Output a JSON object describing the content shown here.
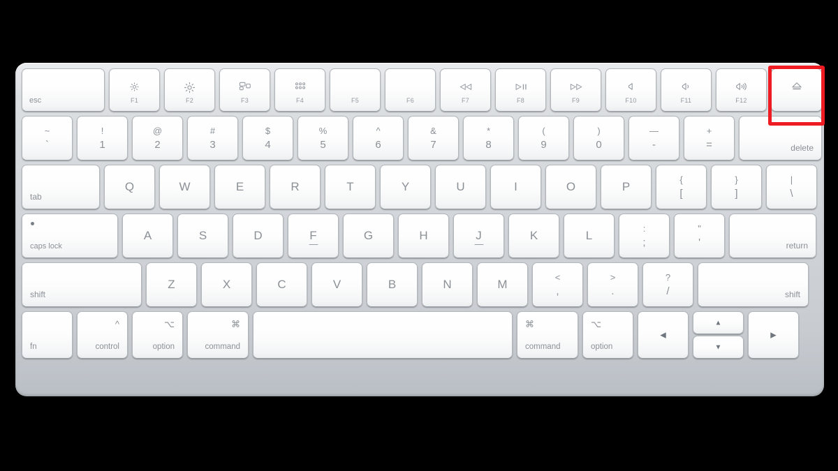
{
  "device": {
    "name": "Apple Magic Keyboard",
    "layout": "US ANSI, compact with eject key"
  },
  "highlight": {
    "target_key": "eject",
    "color": "#ee1c22",
    "shape": "rectangle-outline"
  },
  "background_color": "#000000",
  "rows": {
    "function": [
      {
        "name": "esc",
        "label": "esc",
        "glyph": "",
        "fn": "",
        "style": "esc"
      },
      {
        "name": "f1",
        "label": "",
        "glyph": "☀",
        "fn": "F1",
        "icon": "brightness-down-icon"
      },
      {
        "name": "f2",
        "label": "",
        "glyph": "☀",
        "fn": "F2",
        "icon": "brightness-up-icon"
      },
      {
        "name": "f3",
        "label": "",
        "glyph": "",
        "fn": "F3",
        "icon": "mission-control-icon"
      },
      {
        "name": "f4",
        "label": "",
        "glyph": "",
        "fn": "F4",
        "icon": "launchpad-icon"
      },
      {
        "name": "f5",
        "label": "",
        "glyph": "",
        "fn": "F5",
        "icon": ""
      },
      {
        "name": "f6",
        "label": "",
        "glyph": "",
        "fn": "F6",
        "icon": ""
      },
      {
        "name": "f7",
        "label": "",
        "glyph": "◅◅",
        "fn": "F7",
        "icon": "rewind-icon"
      },
      {
        "name": "f8",
        "label": "",
        "glyph": "▻||",
        "fn": "F8",
        "icon": "play-pause-icon"
      },
      {
        "name": "f9",
        "label": "",
        "glyph": "▻▻",
        "fn": "F9",
        "icon": "fast-forward-icon"
      },
      {
        "name": "f10",
        "label": "",
        "glyph": "◁",
        "fn": "F10",
        "icon": "mute-icon"
      },
      {
        "name": "f11",
        "label": "",
        "glyph": "◁)",
        "fn": "F11",
        "icon": "volume-down-icon"
      },
      {
        "name": "f12",
        "label": "",
        "glyph": "◁))",
        "fn": "F12",
        "icon": "volume-up-icon"
      },
      {
        "name": "eject",
        "label": "",
        "glyph": "⏏",
        "fn": "",
        "icon": "eject-icon"
      }
    ],
    "number": [
      {
        "name": "grave",
        "top": "~",
        "bot": "`"
      },
      {
        "name": "one",
        "top": "!",
        "bot": "1"
      },
      {
        "name": "two",
        "top": "@",
        "bot": "2"
      },
      {
        "name": "three",
        "top": "#",
        "bot": "3"
      },
      {
        "name": "four",
        "top": "$",
        "bot": "4"
      },
      {
        "name": "five",
        "top": "%",
        "bot": "5"
      },
      {
        "name": "six",
        "top": "^",
        "bot": "6"
      },
      {
        "name": "seven",
        "top": "&",
        "bot": "7"
      },
      {
        "name": "eight",
        "top": "*",
        "bot": "8"
      },
      {
        "name": "nine",
        "top": "(",
        "bot": "9"
      },
      {
        "name": "zero",
        "top": ")",
        "bot": "0"
      },
      {
        "name": "minus",
        "top": "—",
        "bot": "-"
      },
      {
        "name": "equal",
        "top": "+",
        "bot": "="
      },
      {
        "name": "delete",
        "label": "delete"
      }
    ],
    "qwerty": [
      {
        "name": "tab",
        "label": "tab"
      },
      {
        "name": "q",
        "letter": "Q"
      },
      {
        "name": "w",
        "letter": "W"
      },
      {
        "name": "e",
        "letter": "E"
      },
      {
        "name": "r",
        "letter": "R"
      },
      {
        "name": "t",
        "letter": "T"
      },
      {
        "name": "y",
        "letter": "Y"
      },
      {
        "name": "u",
        "letter": "U"
      },
      {
        "name": "i",
        "letter": "I"
      },
      {
        "name": "o",
        "letter": "O"
      },
      {
        "name": "p",
        "letter": "P"
      },
      {
        "name": "bracket-left",
        "top": "{",
        "bot": "["
      },
      {
        "name": "bracket-right",
        "top": "}",
        "bot": "]"
      },
      {
        "name": "backslash",
        "top": "|",
        "bot": "\\"
      }
    ],
    "home": [
      {
        "name": "caps-lock",
        "label": "caps lock"
      },
      {
        "name": "a",
        "letter": "A"
      },
      {
        "name": "s",
        "letter": "S"
      },
      {
        "name": "d",
        "letter": "D"
      },
      {
        "name": "f",
        "letter": "F",
        "bump": true
      },
      {
        "name": "g",
        "letter": "G"
      },
      {
        "name": "h",
        "letter": "H"
      },
      {
        "name": "j",
        "letter": "J",
        "bump": true
      },
      {
        "name": "k",
        "letter": "K"
      },
      {
        "name": "l",
        "letter": "L"
      },
      {
        "name": "semicolon",
        "top": ":",
        "bot": ";"
      },
      {
        "name": "quote",
        "top": "\"",
        "bot": "'"
      },
      {
        "name": "return",
        "label": "return"
      }
    ],
    "shift": [
      {
        "name": "shift-left",
        "label": "shift"
      },
      {
        "name": "z",
        "letter": "Z"
      },
      {
        "name": "x",
        "letter": "X"
      },
      {
        "name": "c",
        "letter": "C"
      },
      {
        "name": "v",
        "letter": "V"
      },
      {
        "name": "b",
        "letter": "B"
      },
      {
        "name": "n",
        "letter": "N"
      },
      {
        "name": "m",
        "letter": "M"
      },
      {
        "name": "comma",
        "top": "<",
        "bot": ","
      },
      {
        "name": "period",
        "top": ">",
        "bot": "."
      },
      {
        "name": "slash",
        "top": "?",
        "bot": "/"
      },
      {
        "name": "shift-right",
        "label": "shift"
      }
    ],
    "bottom": [
      {
        "name": "fn",
        "label": "fn",
        "sym": ""
      },
      {
        "name": "control",
        "label": "control",
        "sym": "^"
      },
      {
        "name": "option-left",
        "label": "option",
        "sym": "⌥"
      },
      {
        "name": "command-left",
        "label": "command",
        "sym": "⌘"
      },
      {
        "name": "space",
        "label": "",
        "sym": ""
      },
      {
        "name": "command-right",
        "label": "command",
        "sym": "⌘"
      },
      {
        "name": "option-right",
        "label": "option",
        "sym": "⌥"
      },
      {
        "name": "arrow-left",
        "label": "◀",
        "sym": ""
      },
      {
        "name": "arrow-up",
        "label": "▲",
        "sym": ""
      },
      {
        "name": "arrow-down",
        "label": "▼",
        "sym": ""
      },
      {
        "name": "arrow-right",
        "label": "▶",
        "sym": ""
      }
    ]
  }
}
